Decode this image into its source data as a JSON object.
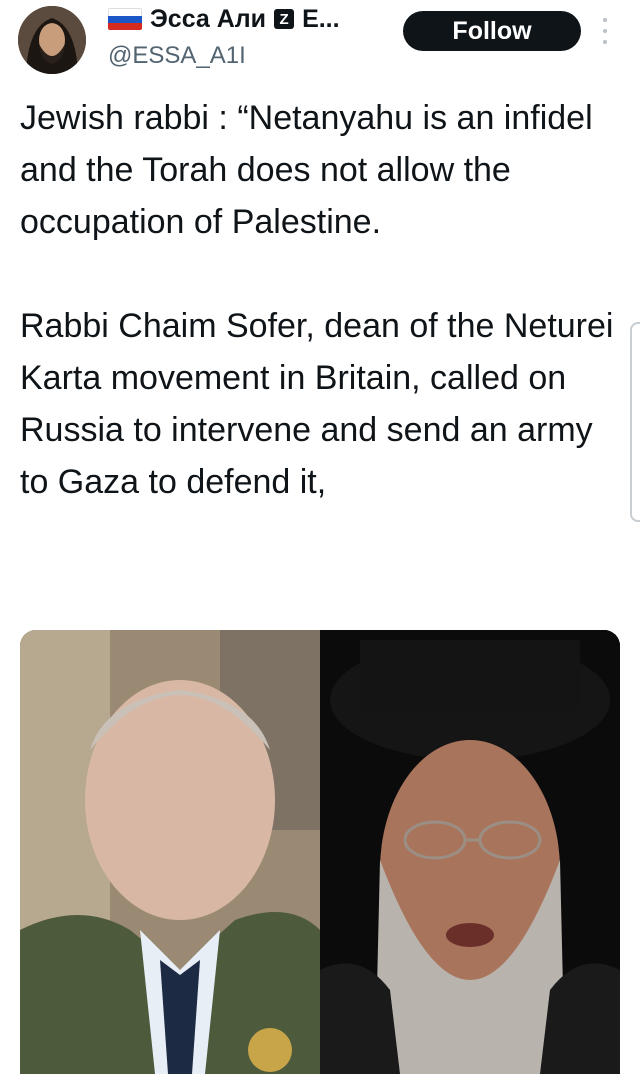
{
  "author": {
    "display_name": "Эсса Али",
    "name_suffix": "E...",
    "badge_letter": "Z",
    "handle": "@ESSA_A1I"
  },
  "actions": {
    "follow_label": "Follow"
  },
  "tweet": {
    "paragraphs": [
      "Jewish rabbi : “Netanyahu is an infidel and the Torah does not allow the occupation of Palestine.",
      "Rabbi Chaim Sofer, dean of the Neturei Karta movement in Britain, called on Russia to intervene and send an army to Gaza to defend it,"
    ]
  },
  "icons": {
    "flag": "russia-flag-icon",
    "badge": "z-badge-icon",
    "more": "more-vertical-icon"
  },
  "colors": {
    "follow_bg": "#0f1419",
    "handle": "#536471",
    "text": "#0f1419"
  }
}
